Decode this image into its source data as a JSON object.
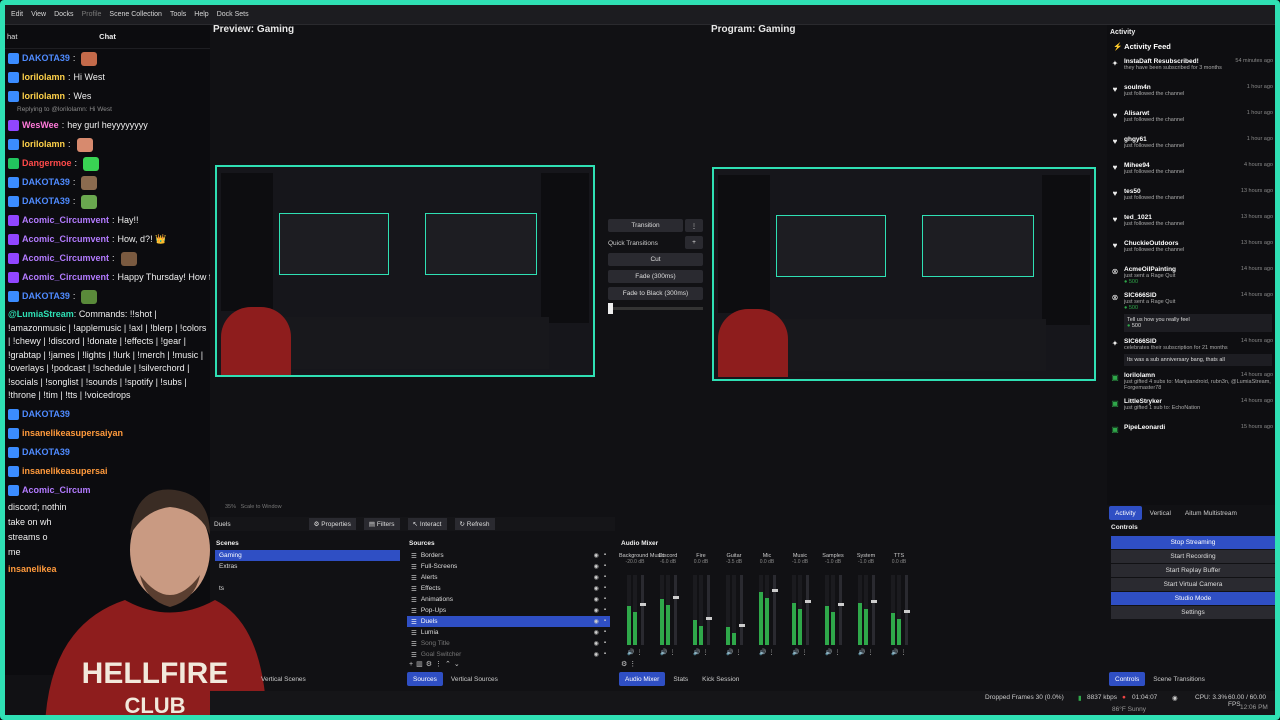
{
  "menu": [
    "Edit",
    "View",
    "Docks",
    "Profile",
    "Scene Collection",
    "Tools",
    "Help",
    "Dock Sets"
  ],
  "chat": {
    "title": "Chat",
    "cut_label": "hat",
    "reply_to": "Replying to @lorilolamn: Hi West",
    "messages": [
      {
        "user": "DAKOTA39",
        "text": "",
        "color": "#4f8bff",
        "badge": "#3b8cff",
        "emote": "#c46a4a"
      },
      {
        "user": "lorilolamn",
        "text": "Hi West",
        "color": "#ffd24a",
        "badge": "#3b8cff"
      },
      {
        "user": "lorilolamn",
        "text": "Wes",
        "color": "#ffd24a",
        "badge": "#3b8cff"
      },
      {
        "user": "WesWee",
        "text": "hey gurl heyyyyyyyy",
        "color": "#ff7ad9",
        "badge": "#9146ff"
      },
      {
        "user": "lorilolamn",
        "text": "",
        "color": "#ffd24a",
        "badge": "#3b8cff",
        "emote": "#d78a6e"
      },
      {
        "user": "Dangermoe",
        "text": "",
        "color": "#ff4a4a",
        "badge": "#22c55e",
        "emote": "#39d353"
      },
      {
        "user": "DAKOTA39",
        "text": "",
        "color": "#4f8bff",
        "badge": "#3b8cff",
        "emote": "#8b6b4f"
      },
      {
        "user": "DAKOTA39",
        "text": "",
        "color": "#4f8bff",
        "badge": "#3b8cff",
        "emote": "#6aa84f"
      },
      {
        "user": "Acomic_Circumvent",
        "text": "Hay!!",
        "color": "#b37bff",
        "badge": "#9146ff"
      },
      {
        "user": "Acomic_Circumvent",
        "text": "How, d?! 👑",
        "color": "#b37bff",
        "badge": "#9146ff"
      },
      {
        "user": "Acomic_Circumvent",
        "text": "",
        "color": "#b37bff",
        "badge": "#9146ff",
        "emote": "#7a5a40"
      },
      {
        "user": "Acomic_Circumvent",
        "text": "Happy Thursday! How for art thou?!",
        "color": "#b37bff",
        "badge": "#9146ff"
      },
      {
        "user": "DAKOTA39",
        "text": "",
        "color": "#4f8bff",
        "badge": "#3b8cff",
        "emote": "#5a8a3a"
      }
    ],
    "commands_user": "@LumiaStream",
    "commands_text": "Commands: !!shot | !amazonmusic | !applemusic | !axl | !blerp | !colors | !chewy | !discord | !donate | !effects | !gear | !grabtap | !james | !lights | !lurk | !merch | !music | !overlays | !podcast | !schedule | !silverchord | !socials | !songlist | !sounds | !spotify | !subs | !throne | !tim | !tts | !voicedrops",
    "tail": [
      {
        "user": "DAKOTA39",
        "color": "#4f8bff"
      },
      {
        "user": "insanelikeasupersaiyan",
        "color": "#ff9a3c"
      },
      {
        "user": "DAKOTA39",
        "color": "#4f8bff"
      },
      {
        "user": "insanelikeasupersai",
        "color": "#ff9a3c"
      },
      {
        "user": "Acomic_Circum",
        "color": "#b37bff"
      }
    ],
    "partial": [
      "discord; nothin",
      "take on wh",
      "streams o",
      "me"
    ],
    "partial_user": "insanelikea"
  },
  "preview": {
    "title": "Preview: Gaming"
  },
  "program": {
    "title": "Program: Gaming"
  },
  "zoom": {
    "value": "35%",
    "mode": "Scale to Window"
  },
  "transitions": {
    "transition_label": "Transition",
    "quick_label": "Quick Transitions",
    "items": [
      "Cut",
      "Fade (300ms)",
      "Fade to Black (300ms)"
    ]
  },
  "toolbar": {
    "scene_name": "Duels",
    "properties": "Properties",
    "filters": "Filters",
    "interact": "Interact",
    "refresh": "Refresh"
  },
  "scenes": {
    "title": "Scenes",
    "items": [
      "Gaming",
      "Extras",
      "",
      "ts"
    ],
    "tabs": [
      "Vertical Scenes"
    ]
  },
  "sources": {
    "title": "Sources",
    "items": [
      "Borders",
      "Full-Screens",
      "Alerts",
      "Effects",
      "Animations",
      "Pop-Ups",
      "Duels",
      "Lumia",
      "Song Title",
      "Goal Switcher"
    ],
    "selected": "Duels",
    "tabs": [
      "Sources",
      "Vertical Sources"
    ]
  },
  "mixer": {
    "title": "Audio Mixer",
    "channels": [
      {
        "name": "Background Music",
        "db": "-20.0 dB",
        "level": 0.55
      },
      {
        "name": "Discord",
        "db": "-6.0 dB",
        "level": 0.65
      },
      {
        "name": "Fire",
        "db": "0.0 dB",
        "level": 0.35
      },
      {
        "name": "Guitar",
        "db": "-3.5 dB",
        "level": 0.25
      },
      {
        "name": "Mic",
        "db": "0.0 dB",
        "level": 0.75
      },
      {
        "name": "Music",
        "db": "-1.0 dB",
        "level": 0.6
      },
      {
        "name": "Samples",
        "db": "-1.0 dB",
        "level": 0.55
      },
      {
        "name": "System",
        "db": "-1.0 dB",
        "level": 0.6
      },
      {
        "name": "TTS",
        "db": "0.0 dB",
        "level": 0.45
      }
    ],
    "tabs": [
      "Audio Mixer",
      "Stats",
      "Kick Session"
    ]
  },
  "activity": {
    "dock_title": "Activity",
    "feed_title": "Activity Feed",
    "items": [
      {
        "name": "InstaDaft Resubscribed!",
        "desc": "they have been subscribed for 3 months",
        "time": "54 minutes ago",
        "icon": "✦"
      },
      {
        "name": "soulm4n",
        "desc": "just followed the channel",
        "time": "1 hour ago",
        "icon": "♥"
      },
      {
        "name": "Alisarwt",
        "desc": "just followed the channel",
        "time": "1 hour ago",
        "icon": "♥"
      },
      {
        "name": "ghgy61",
        "desc": "just followed the channel",
        "time": "1 hour ago",
        "icon": "♥"
      },
      {
        "name": "Mihee94",
        "desc": "just followed the channel",
        "time": "4 hours ago",
        "icon": "♥"
      },
      {
        "name": "tes50",
        "desc": "just followed the channel",
        "time": "13 hours ago",
        "icon": "♥"
      },
      {
        "name": "ted_1021",
        "desc": "just followed the channel",
        "time": "13 hours ago",
        "icon": "♥"
      },
      {
        "name": "ChuckieOutdoors",
        "desc": "just followed the channel",
        "time": "13 hours ago",
        "icon": "♥"
      },
      {
        "name": "AcmeOilPainting",
        "desc": "just sent a Rage Quit",
        "time": "14 hours ago",
        "icon": "⊗"
      },
      {
        "name": "SIC666SID",
        "desc": "just sent a Rage Quit",
        "time": "14 hours ago",
        "icon": "⊗"
      },
      {
        "name": "SIC666SID",
        "desc": "celebrates their subscription for 21 months",
        "time": "14 hours ago",
        "icon": "✦"
      },
      {
        "name": "lorilolamn",
        "desc": "just gifted 4 subs to: Marijuandroid, rubn3n, @LumiaStream, Forgemaster78",
        "time": "14 hours ago",
        "icon": "▣"
      },
      {
        "name": "LittleStryker",
        "desc": "just gifted 1 sub to: EchoNation",
        "time": "14 hours ago",
        "icon": "▣"
      },
      {
        "name": "PipeLeonardi",
        "desc": "",
        "time": "15 hours ago",
        "icon": "▣"
      }
    ],
    "rage_amount": "500",
    "note1": "Tell us how you really feel",
    "note2": "Its was a sub anniversary bang, thats all",
    "tabs": [
      "Activity",
      "Vertical",
      "Aitum Multistream"
    ]
  },
  "controls": {
    "title": "Controls",
    "buttons": [
      "Stop Streaming",
      "Start Recording",
      "Start Replay Buffer",
      "Start Virtual Camera",
      "Studio Mode",
      "Settings"
    ],
    "tabs": [
      "Controls",
      "Scene Transitions"
    ]
  },
  "status": {
    "dropped": "Dropped Frames 30 (0.0%)",
    "kbps": "8837 kbps",
    "time": "01:04:07",
    "cpu": "CPU: 3.3%",
    "fps": "60.00 / 60.00 FPS",
    "weather": "86°F Sunny",
    "clock": "12:06 PM"
  }
}
